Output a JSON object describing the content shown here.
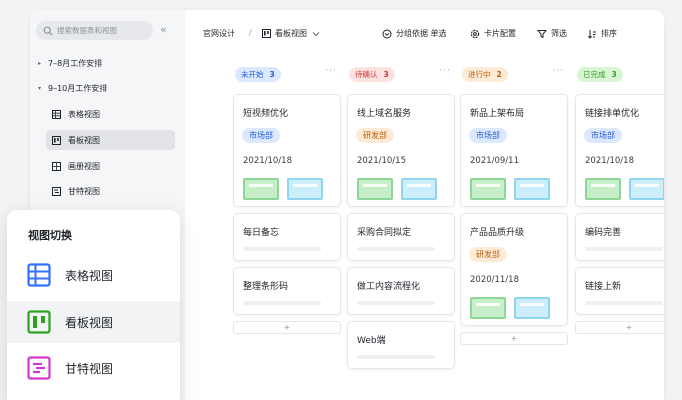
{
  "sidebar": {
    "search_placeholder": "搜索数据表和视图",
    "collapse_glyph": "«",
    "groups": [
      {
        "label": "7–8月工作安排",
        "arrow": "▸"
      },
      {
        "label": "9–10月工作安排",
        "arrow": "▾"
      }
    ],
    "views": [
      {
        "label": "表格视图",
        "icon": "grid-view-icon"
      },
      {
        "label": "看板视图",
        "icon": "kanban-view-icon"
      },
      {
        "label": "画册视图",
        "icon": "gallery-view-icon"
      },
      {
        "label": "甘特视图",
        "icon": "gantt-view-icon"
      }
    ]
  },
  "toolbar": {
    "breadcrumb": "官网设计",
    "separator": "/",
    "view_name": "看板视图",
    "group_by": "分组依据 单选",
    "card_config": "卡片配置",
    "filter": "筛选",
    "sort": "排序"
  },
  "columns": [
    {
      "label": "未开始",
      "count": "3",
      "bg": "#dce8fd",
      "fg": "#245bdb",
      "cards": [
        {
          "title": "短视频优化",
          "tag": "市场部",
          "tag_color": "blue",
          "date": "2021/10/18",
          "thumbs": true
        },
        {
          "title": "每日备忘"
        },
        {
          "title": "整理条形码"
        }
      ]
    },
    {
      "label": "待确认",
      "count": "3",
      "bg": "#fde2e2",
      "fg": "#d83931",
      "cards": [
        {
          "title": "线上域名服务",
          "tag": "研发部",
          "tag_color": "orange",
          "date": "2021/10/15",
          "thumbs": true
        },
        {
          "title": "采购合同拟定"
        },
        {
          "title": "做工内容流程化"
        },
        {
          "title": "Web端"
        }
      ]
    },
    {
      "label": "进行中",
      "count": "2",
      "bg": "#fdebd8",
      "fg": "#c25c06",
      "cards": [
        {
          "title": "新品上架布局",
          "tag": "市场部",
          "tag_color": "blue",
          "date": "2021/09/11",
          "thumbs": true
        },
        {
          "title": "产品品质升级",
          "tag": "研发部",
          "tag_color": "orange",
          "date": "2020/11/18",
          "thumbs": true
        }
      ]
    },
    {
      "label": "已完成",
      "count": "3",
      "bg": "#d9f5d6",
      "fg": "#2ea121",
      "cards": [
        {
          "title": "链接排单优化",
          "tag": "市场部",
          "tag_color": "blue",
          "date": "2021/10/18",
          "thumbs": true
        },
        {
          "title": "编码完善"
        },
        {
          "title": "链接上新"
        }
      ]
    }
  ],
  "add_glyph": "+",
  "more_glyph": "···",
  "switcher": {
    "title": "视图切换",
    "options": [
      {
        "label": "表格视图",
        "icon": "table-view-icon",
        "color": "#3370ff"
      },
      {
        "label": "看板视图",
        "icon": "kanban-view-icon",
        "color": "#2ea121"
      },
      {
        "label": "甘特视图",
        "icon": "gantt-view-icon",
        "color": "#d136d1"
      }
    ]
  }
}
